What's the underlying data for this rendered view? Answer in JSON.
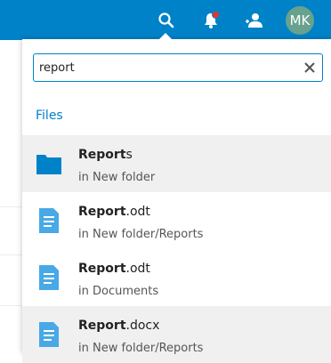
{
  "header": {
    "avatar_initials": "MK",
    "icons": [
      "search-icon",
      "notifications-icon",
      "contacts-icon"
    ],
    "brand_color": "#0082c9",
    "notification_dot_color": "#e9322d"
  },
  "search": {
    "value": "report",
    "section_title": "Files"
  },
  "results": [
    {
      "match": "Report",
      "rest": "s",
      "location": "in New folder",
      "type": "folder",
      "highlighted": true
    },
    {
      "match": "Report",
      "rest": ".odt",
      "location": "in New folder/Reports",
      "type": "document",
      "highlighted": false
    },
    {
      "match": "Report",
      "rest": ".odt",
      "location": "in Documents",
      "type": "document",
      "highlighted": false
    },
    {
      "match": "Report",
      "rest": ".docx",
      "location": "in New folder/Reports",
      "type": "document",
      "highlighted": true
    }
  ]
}
